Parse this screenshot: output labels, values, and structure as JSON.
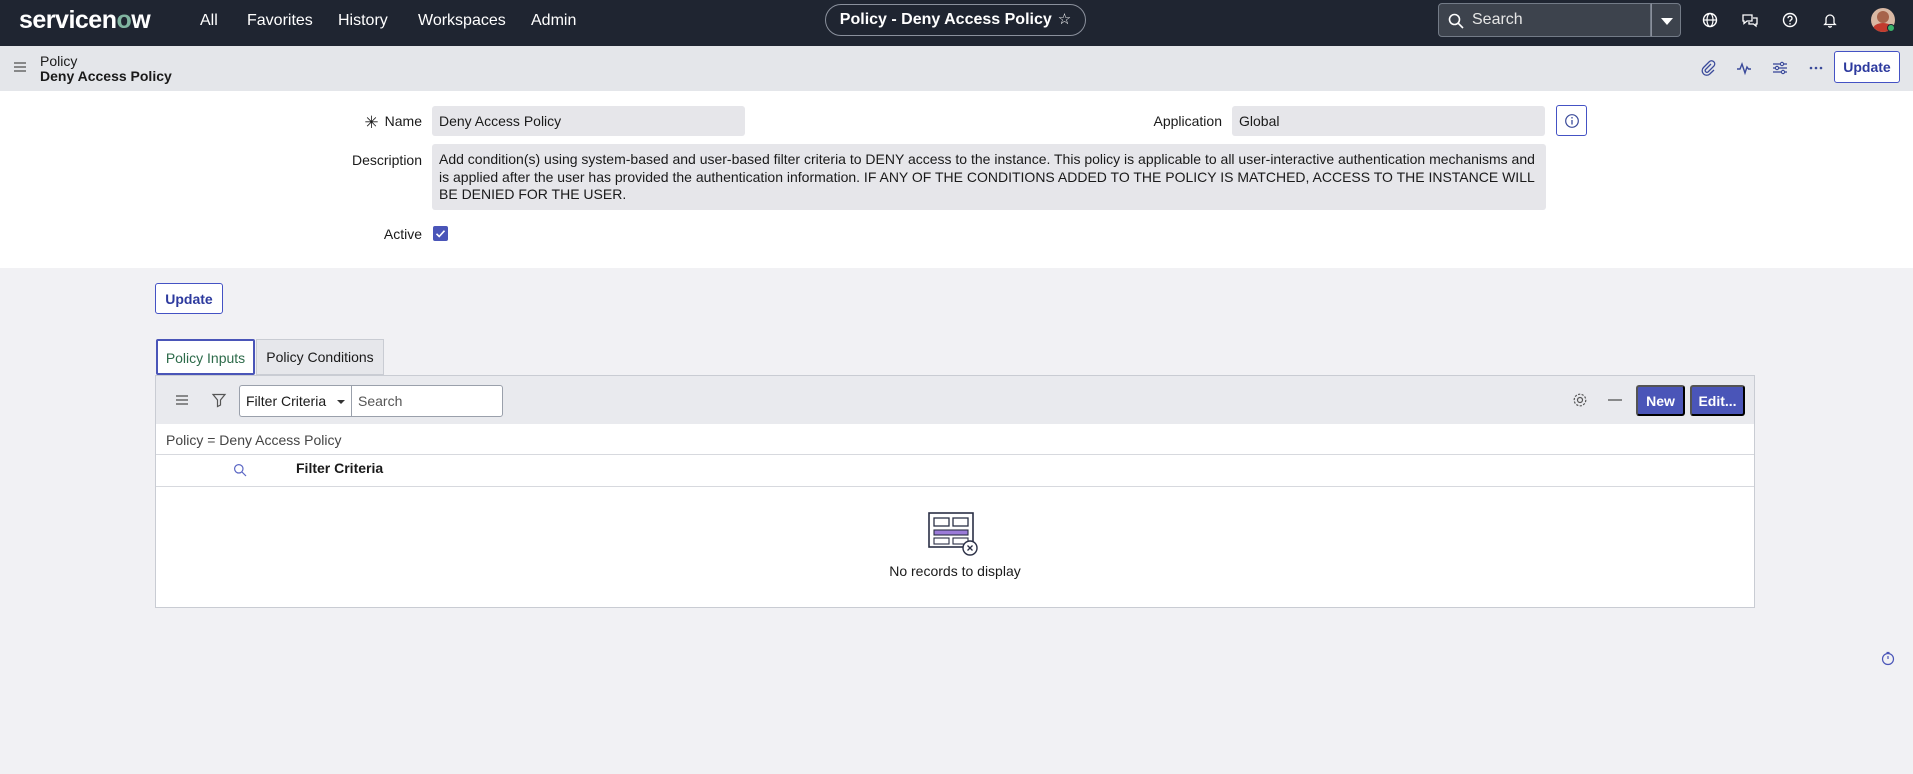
{
  "topnav": {
    "logo_text": "servicenow",
    "links": [
      "All",
      "Favorites",
      "History",
      "Workspaces",
      "Admin"
    ],
    "title_pill": "Policy - Deny Access Policy",
    "search_placeholder": "Search",
    "icons": [
      "globe-icon",
      "chat-icon",
      "help-icon",
      "bell-icon",
      "avatar"
    ]
  },
  "header": {
    "crumb_table": "Policy",
    "crumb_record": "Deny Access Policy",
    "update_label": "Update",
    "icons": [
      "paperclip-icon",
      "activity-icon",
      "sliders-icon",
      "more-icon"
    ]
  },
  "form": {
    "name_label": "Name",
    "name_value": "Deny Access Policy",
    "application_label": "Application",
    "application_value": "Global",
    "description_label": "Description",
    "description_value": "Add condition(s) using system-based and user-based filter criteria to DENY access to the instance. This policy is applicable to all user-interactive authentication mechanisms and is applied after the user has provided the authentication information. IF ANY OF THE CONDITIONS ADDED TO THE POLICY IS MATCHED, ACCESS TO THE INSTANCE WILL BE DENIED FOR THE USER.",
    "active_label": "Active",
    "active_checked": true
  },
  "bottom_update_label": "Update",
  "tabs": [
    {
      "label": "Policy Inputs",
      "active": true
    },
    {
      "label": "Policy Conditions",
      "active": false
    }
  ],
  "list": {
    "filter_field": "Filter Criteria",
    "search_placeholder": "Search",
    "new_label": "New",
    "edit_label": "Edit...",
    "breadcrumb": "Policy = Deny Access Policy",
    "column_header": "Filter Criteria",
    "empty_message": "No records to display"
  },
  "colors": {
    "nav_bg": "#1f2531",
    "accent": "#4a55b8",
    "logo_accent": "#81b5a1"
  }
}
